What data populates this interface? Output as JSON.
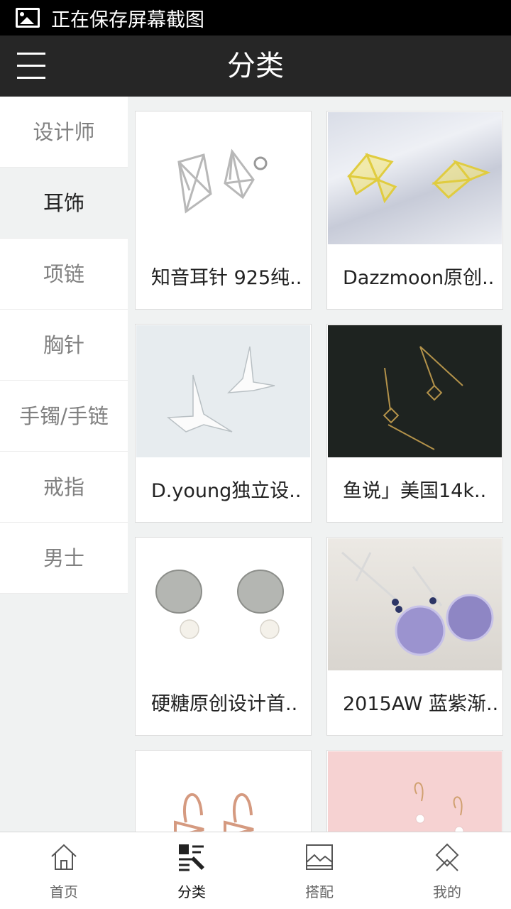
{
  "status_bar": {
    "text": "正在保存屏幕截图"
  },
  "header": {
    "title": "分类"
  },
  "categories": [
    {
      "label": "设计师",
      "active": false
    },
    {
      "label": "耳饰",
      "active": true
    },
    {
      "label": "项链",
      "active": false
    },
    {
      "label": "胸针",
      "active": false
    },
    {
      "label": "手镯/手链",
      "active": false
    },
    {
      "label": "戒指",
      "active": false
    },
    {
      "label": "男士",
      "active": false
    }
  ],
  "products": [
    {
      "name": "知音耳针 925纯..",
      "image": "silver-geometric-studs"
    },
    {
      "name": "Dazzmoon原创..",
      "image": "yellow-fan-earrings"
    },
    {
      "name": "D.young独立设..",
      "image": "silver-swallow-earrings"
    },
    {
      "name": "鱼说」美国14k..",
      "image": "gold-threader-earrings"
    },
    {
      "name": "硬糖原创设计首..",
      "image": "silver-pearl-coin-earrings"
    },
    {
      "name": "2015AW 蓝紫渐..",
      "image": "blue-purple-ball-earrings"
    },
    {
      "name": "",
      "image": "rose-gold-bow-earrings"
    },
    {
      "name": "",
      "image": "pink-drop-earrings"
    }
  ],
  "bottom_nav": [
    {
      "label": "首页",
      "icon": "home-icon",
      "active": false
    },
    {
      "label": "分类",
      "icon": "category-icon",
      "active": true
    },
    {
      "label": "搭配",
      "icon": "picture-icon",
      "active": false
    },
    {
      "label": "我的",
      "icon": "profile-icon",
      "active": false
    }
  ]
}
